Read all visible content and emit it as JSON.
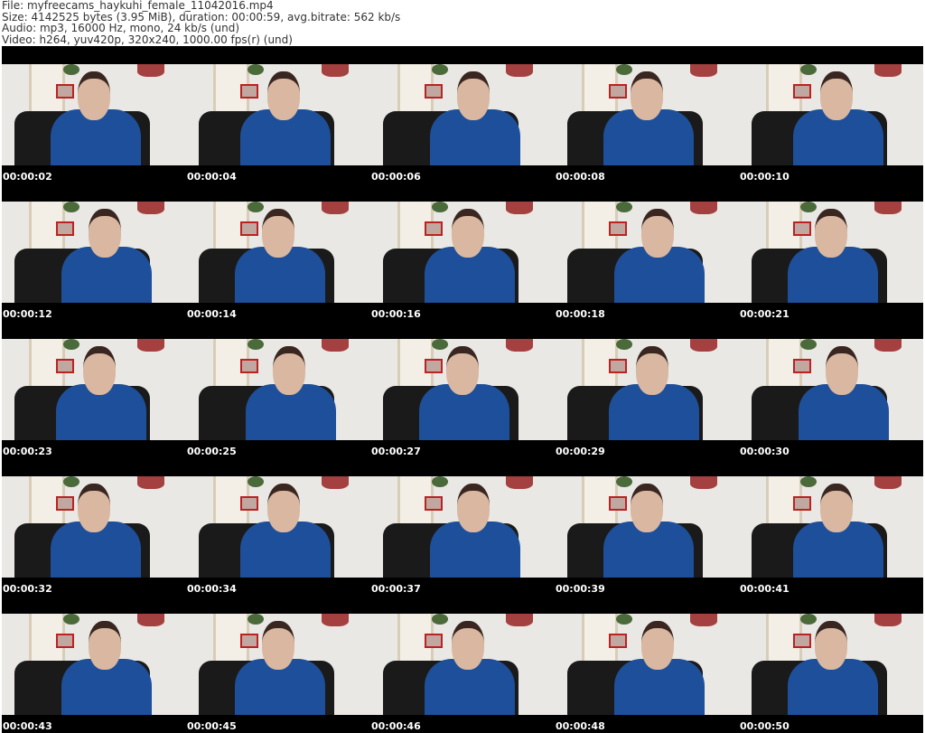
{
  "header": {
    "file": "File: myfreecams_haykuhi_female_11042016.mp4",
    "size": "Size: 4142525 bytes (3.95 MiB), duration: 00:00:59, avg.bitrate: 562 kb/s",
    "audio": "Audio: mp3, 16000 Hz, mono, 24 kb/s (und)",
    "video": "Video: h264, yuv420p, 320x240, 1000.00 fps(r) (und)"
  },
  "timestamps": [
    [
      "00:00:02",
      "00:00:04",
      "00:00:06",
      "00:00:08",
      "00:00:10"
    ],
    [
      "00:00:12",
      "00:00:14",
      "00:00:16",
      "00:00:18",
      "00:00:21"
    ],
    [
      "00:00:23",
      "00:00:25",
      "00:00:27",
      "00:00:29",
      "00:00:30"
    ],
    [
      "00:00:32",
      "00:00:34",
      "00:00:37",
      "00:00:39",
      "00:00:41"
    ],
    [
      "00:00:43",
      "00:00:45",
      "00:00:46",
      "00:00:48",
      "00:00:50"
    ]
  ]
}
